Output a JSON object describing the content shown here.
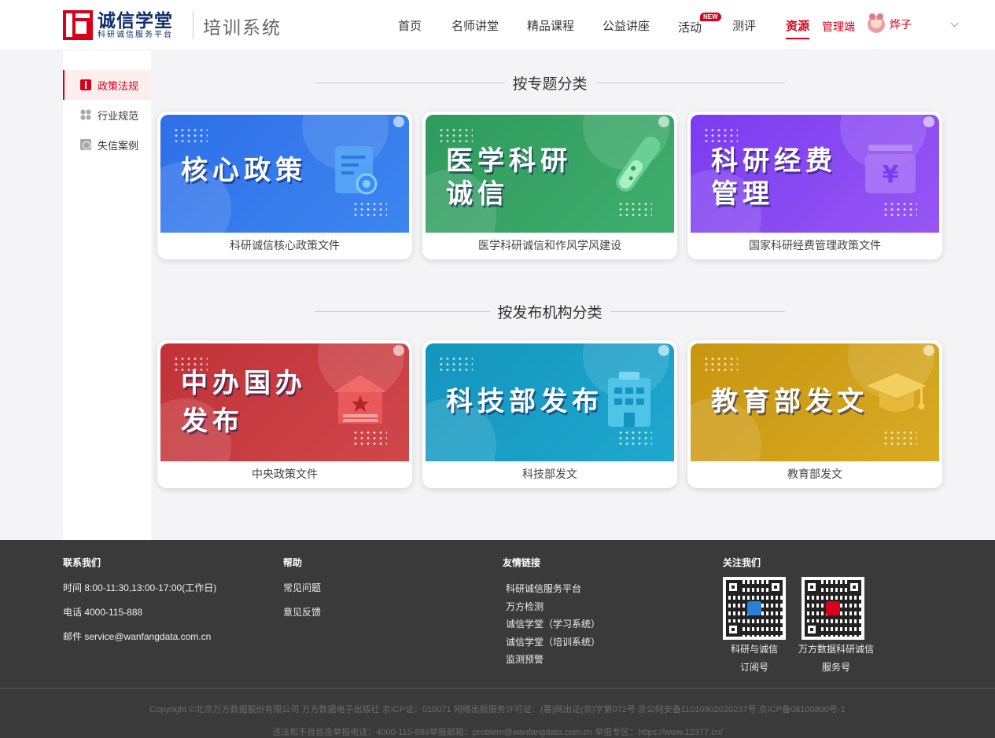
{
  "header": {
    "logo_main": "诚信学堂",
    "logo_sub": "科研诚信服务平台",
    "system_title": "培训系统",
    "nav": [
      {
        "label": "首页"
      },
      {
        "label": "名师讲堂"
      },
      {
        "label": "精品课程"
      },
      {
        "label": "公益讲座"
      },
      {
        "label": "活动"
      },
      {
        "label": "测评"
      },
      {
        "label": "资源"
      },
      {
        "label": "管理端"
      }
    ],
    "new_badge": "NEW",
    "active_nav": "资源",
    "user_name": "烨子"
  },
  "sidebar": {
    "items": [
      {
        "label": "政策法规",
        "icon": "book-icon",
        "active": true
      },
      {
        "label": "行业规范",
        "icon": "grid-icon",
        "active": false
      },
      {
        "label": "失信案例",
        "icon": "case-icon",
        "active": false
      }
    ]
  },
  "sections": [
    {
      "title": "按专题分类",
      "cards": [
        {
          "banner_line1": "核心政策",
          "banner_line2": "",
          "caption": "科研诚信核心政策文件",
          "color": "#3477ea",
          "illustration": "certificate-icon"
        },
        {
          "banner_line1": "医学科研",
          "banner_line2": "诚信",
          "caption": "医学科研诚信和作风学风建设",
          "color": "#35a062",
          "illustration": "test-tube-icon"
        },
        {
          "banner_line1": "科研经费",
          "banner_line2": "管理",
          "caption": "国家科研经费管理政策文件",
          "color": "#8848f0",
          "illustration": "yuan-icon"
        }
      ]
    },
    {
      "title": "按发布机构分类",
      "cards": [
        {
          "banner_line1": "中办国办",
          "banner_line2": "发布",
          "caption": "中央政策文件",
          "color": "#c8373b",
          "illustration": "government-building-icon"
        },
        {
          "banner_line1": "科技部发布",
          "banner_line2": "",
          "caption": "科技部发文",
          "color": "#1a9fc4",
          "illustration": "office-building-icon"
        },
        {
          "banner_line1": "教育部发文",
          "banner_line2": "",
          "caption": "教育部发文",
          "color": "#d1a119",
          "illustration": "graduation-cap-icon"
        }
      ]
    }
  ],
  "footer": {
    "contact": {
      "title": "联系我们",
      "time": "时间 8:00-11:30,13:00-17:00(工作日)",
      "phone": "电话 4000-115-888",
      "email": "邮件 service@wanfangdata.com.cn"
    },
    "help": {
      "title": "帮助",
      "links": [
        "常见问题",
        "意见反馈"
      ]
    },
    "friends": {
      "title": "友情链接",
      "links": [
        "科研诚信服务平台",
        "万方检测",
        "诚信学堂（学习系统）",
        "诚信学堂（培训系统）",
        "监测预警"
      ]
    },
    "follow": {
      "title": "关注我们",
      "qrs": [
        {
          "line1": "科研与诚信",
          "line2": "订阅号"
        },
        {
          "line1": "万方数据科研诚信",
          "line2": "服务号"
        }
      ]
    },
    "copyright_line1": "Copyright ©北京万方数据股份有限公司  万方数据电子出版社  京ICP证：010071  网络出版服务许可证：(署)网出证(京)字第072号  京公网安备11010802020237号  京ICP备08100800号-1",
    "copyright_line2": "违法和不良信息举报电话：4000-115-888举报邮箱：problem@wanfangdata.com.cn 举报专区：https://www.12377.cn/"
  },
  "colors": {
    "brand_red": "#d7001a",
    "brand_blue": "#0f2f6b",
    "footer_bg": "#3a3a3a"
  }
}
